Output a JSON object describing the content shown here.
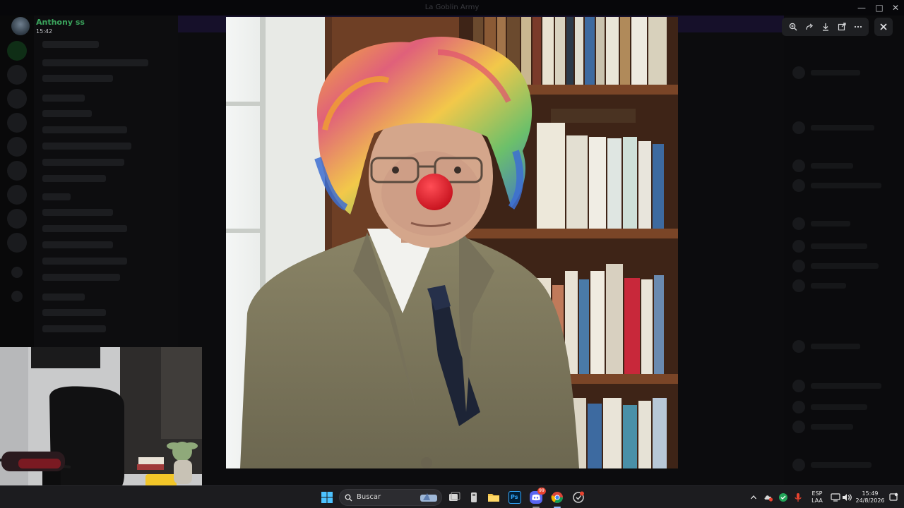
{
  "window": {
    "title": "La Goblin Army",
    "controls": [
      "minimize",
      "maximize",
      "close"
    ]
  },
  "viewer": {
    "author": "Anthony ss",
    "time": "15:42",
    "toolbar": [
      {
        "name": "zoom-icon",
        "label": "Zoom"
      },
      {
        "name": "forward-icon",
        "label": "Forward"
      },
      {
        "name": "download-icon",
        "label": "Download"
      },
      {
        "name": "open-external-icon",
        "label": "Open in browser"
      },
      {
        "name": "more-icon",
        "label": "More"
      }
    ],
    "close_icon": "close-icon"
  },
  "taskbar": {
    "search_placeholder": "Buscar",
    "apps": [
      "windows-start-icon",
      "search-icon",
      "task-view-icon",
      "file-icon",
      "explorer-icon",
      "photoshop-icon",
      "discord-icon",
      "chrome-icon",
      "app-icon"
    ],
    "photoshop_label": "Ps",
    "discord_badge": "99",
    "language_top": "ESP",
    "language_bottom": "LAA",
    "clock_time": "15:49",
    "clock_date": "24/8/2026"
  },
  "colors": {
    "author_name": "#3ba55d",
    "toolbar_bg": "#1e1f22",
    "taskbar_bg": "#1c1c1f",
    "accent": "#5865f2"
  }
}
